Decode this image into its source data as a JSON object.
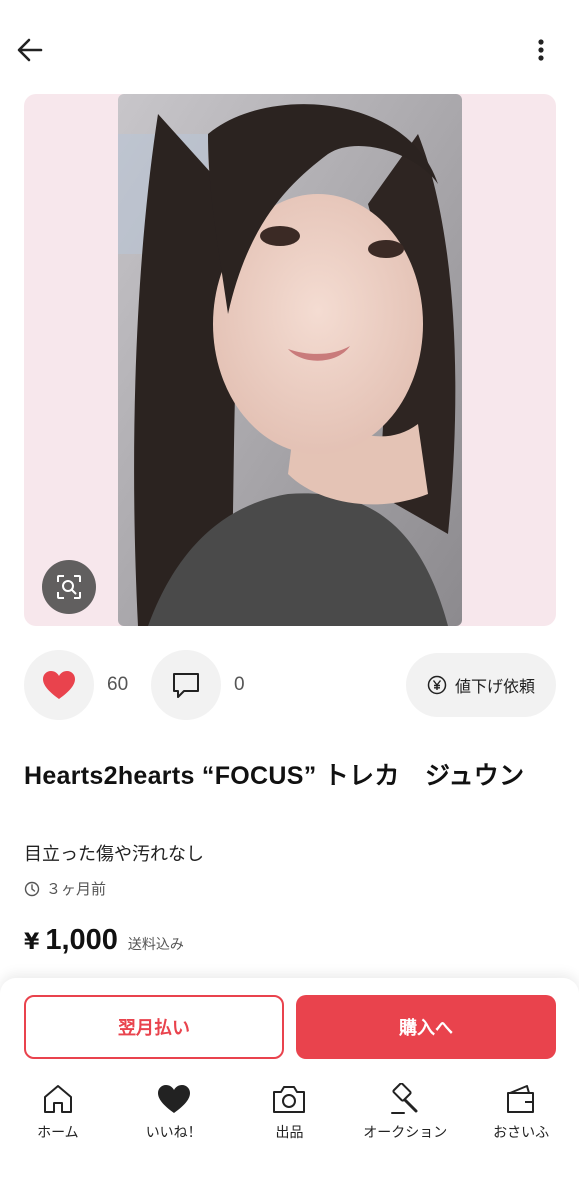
{
  "header": {
    "back_icon": "arrow-left-icon",
    "more_icon": "more-vertical-icon"
  },
  "product": {
    "image_alt": "",
    "lens_icon": "image-search-icon",
    "likes": "60",
    "comments": "0",
    "price_request_label": "値下げ依頼",
    "title": "Hearts2hearts “FOCUS” トレカ　ジュウン",
    "description": "目立った傷や汚れなし",
    "posted": "３ヶ月前",
    "currency": "¥",
    "price": "1,000",
    "shipping_note": "送料込み"
  },
  "buttons": {
    "pay_later": "翌月払い",
    "buy": "購入へ"
  },
  "nav": [
    {
      "label": "ホーム",
      "icon": "home-icon"
    },
    {
      "label": "いいね！",
      "icon": "heart-icon"
    },
    {
      "label": "出品",
      "icon": "camera-icon"
    },
    {
      "label": "オークション",
      "icon": "auction-hammer-icon"
    },
    {
      "label": "おさいふ",
      "icon": "wallet-icon"
    }
  ],
  "colors": {
    "accent": "#e9434d",
    "photo_bg": "#f7e7ec",
    "chip_bg": "#f2f2f2"
  }
}
